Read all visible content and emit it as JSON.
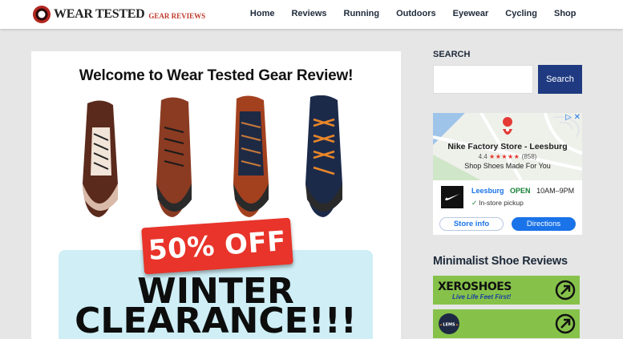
{
  "header": {
    "logo_main": "WEAR TESTED",
    "logo_sub": "GEAR REVIEWS",
    "nav": [
      "Home",
      "Reviews",
      "Running",
      "Outdoors",
      "Eyewear",
      "Cycling",
      "Shop"
    ]
  },
  "main": {
    "welcome": "Welcome to Wear Tested Gear Review!",
    "promo": {
      "badge": "50% OFF",
      "line1": "WINTER",
      "line2": "CLEARANCE!!!"
    }
  },
  "sidebar": {
    "search": {
      "heading": "SEARCH",
      "input_value": "",
      "button": "Search"
    },
    "ad": {
      "store_name": "Nike Factory Store - Leesburg",
      "rating": "4.4",
      "review_count": "(858)",
      "tagline": "Shop Shoes Made For You",
      "city": "Leesburg",
      "status": "OPEN",
      "hours": "10AM–9PM",
      "feature": "In-store pickup",
      "btn_info": "Store info",
      "btn_directions": "Directions"
    },
    "reviews": {
      "heading": "Minimalist Shoe Reviews",
      "banners": [
        {
          "name": "XEROSHOES",
          "tagline": "Live Life Feet First!"
        },
        {
          "name": "LEMS",
          "tagline": ""
        }
      ]
    }
  },
  "colors": {
    "accent": "#1f3a80",
    "promo_red": "#e8342a",
    "promo_bg": "#cfeef6",
    "banner_green": "#86c24a"
  }
}
